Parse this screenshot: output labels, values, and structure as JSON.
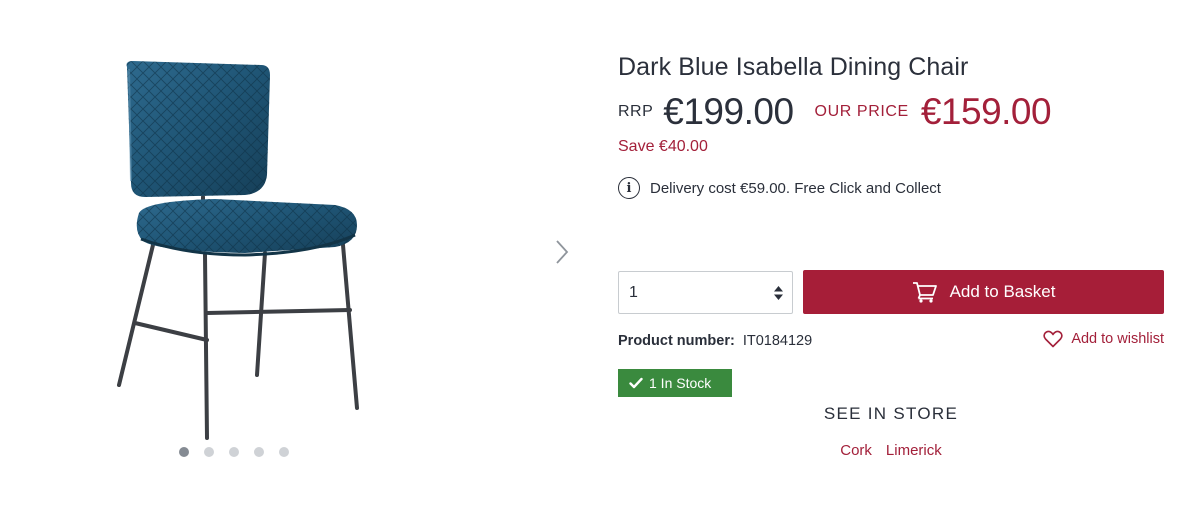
{
  "gallery": {
    "image_alt": "Dark Blue Isabella Dining Chair",
    "slide_count": 5,
    "active_slide": 1
  },
  "product": {
    "title": "Dark Blue Isabella Dining Chair",
    "rrp_label": "RRP",
    "rrp_price": "€199.00",
    "our_price_label": "OUR PRICE",
    "our_price": "€159.00",
    "save_text": "Save €40.00",
    "delivery_text": "Delivery cost €59.00. Free Click and Collect",
    "quantity": "1",
    "add_to_basket_label": "Add to Basket",
    "product_number_label": "Product number:",
    "product_number": "IT0184129",
    "wishlist_label": "Add to wishlist",
    "stock_text": "1 In Stock",
    "see_in_store_label": "SEE IN STORE",
    "stores": [
      "Cork",
      "Limerick"
    ]
  },
  "colors": {
    "accent": "#a61e38",
    "stock_green": "#3a8a3e",
    "text": "#2a2f3a"
  },
  "icons": {
    "info": "info-circle-icon",
    "cart": "cart-icon",
    "heart": "heart-icon",
    "check": "check-icon",
    "next": "chevron-right-icon"
  }
}
